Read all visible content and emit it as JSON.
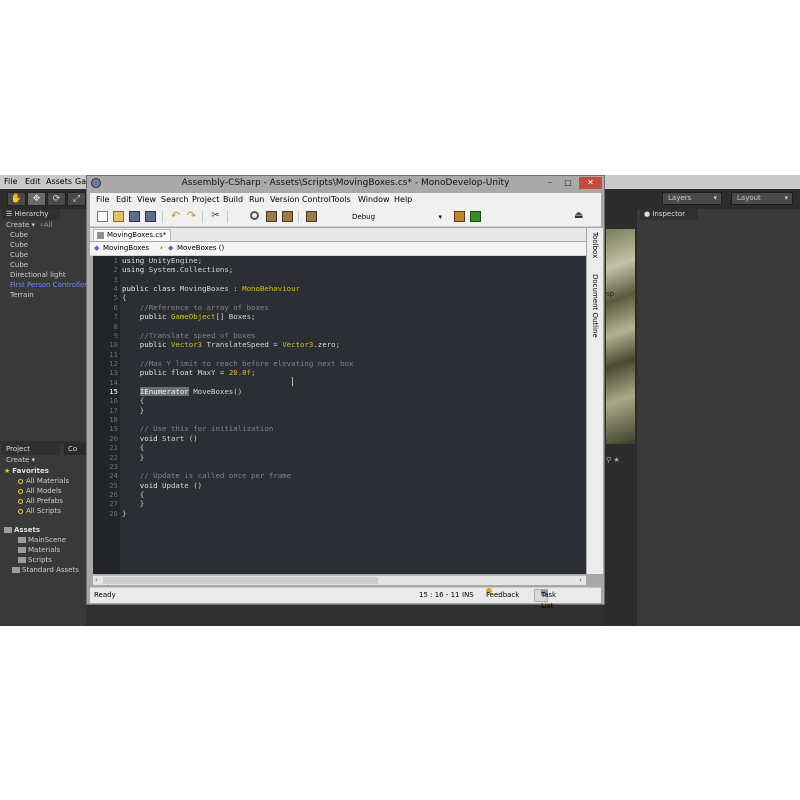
{
  "unity": {
    "menu": [
      "File",
      "Edit",
      "Assets",
      "Ga"
    ],
    "toolbar": {
      "layers_label": "Layers",
      "layout_label": "Layout"
    },
    "hierarchy": {
      "tab": "Hierarchy",
      "create": "Create ▾",
      "search": "⌕All",
      "items": [
        "Cube",
        "Cube",
        "Cube",
        "Cube",
        "Directional light",
        "First Person Controller",
        "Terrain"
      ]
    },
    "project": {
      "tab": "Project",
      "tab2": "Co",
      "create": "Create ▾",
      "favorites_label": "Favorites",
      "favorites": [
        "All Materials",
        "All Models",
        "All Prefabs",
        "All Scripts"
      ],
      "assets_label": "Assets",
      "assets": [
        "MainScene",
        "Materials",
        "Scripts",
        "Standard Assets"
      ]
    },
    "inspector_tab": "Inspector",
    "scene_label": "sp"
  },
  "md": {
    "title": "Assembly-CSharp - Assets\\Scripts\\MovingBoxes.cs* - MonoDevelop-Unity",
    "menu": [
      "File",
      "Edit",
      "View",
      "Search",
      "Project",
      "Build",
      "Run",
      "Version Control",
      "Tools",
      "Window",
      "Help"
    ],
    "config": "Debug",
    "doc_tab": "MovingBoxes.cs*",
    "path": {
      "class": "MovingBoxes",
      "member": "MoveBoxes ()"
    },
    "line_numbers": [
      "1",
      "2",
      "3",
      "4",
      "5",
      "6",
      "7",
      "8",
      "9",
      "10",
      "11",
      "12",
      "13",
      "14",
      "15",
      "16",
      "17",
      "18",
      "19",
      "20",
      "21",
      "22",
      "23",
      "24",
      "25",
      "26",
      "27",
      "28"
    ],
    "current_line": 15,
    "code": {
      "l1a": "using",
      "l1b": " UnityEngine;",
      "l2a": "using",
      "l2b": " System.Collections;",
      "l4a": "public class",
      "l4b": " MovingBoxes : ",
      "l4c": "MonoBehaviour",
      "l5": "{",
      "l6": "    //Reference to array of boxes",
      "l7a": "    public ",
      "l7b": "GameObject",
      "l7c": "[] Boxes;",
      "l9": "    //Translate speed of boxes",
      "l10a": "    public ",
      "l10b": "Vector3",
      "l10c": " TranslateSpeed = ",
      "l10d": "Vector3",
      "l10e": ".zero;",
      "l12": "    //Max Y limit to reach before elevating next box",
      "l13a": "    public float",
      "l13b": " MaxY = ",
      "l13c": "20.0f",
      "l13d": ";",
      "l15a": "    ",
      "l15b": "IEnumerator",
      "l15c": " MoveBoxes()",
      "l16": "    {",
      "l17": "    }",
      "l19": "    // Use this for initialization",
      "l20a": "    void",
      "l20b": " Start ()",
      "l21": "    {",
      "l22": "    }",
      "l24": "    // Update is called once per frame",
      "l25a": "    void",
      "l25b": " Update ()",
      "l26": "    {",
      "l27": "    }",
      "l28": "}"
    },
    "side_tabs": [
      "Toolbox",
      "Document Outline"
    ],
    "status": {
      "ready": "Ready",
      "position": "15 : 16 - 11",
      "mode": "INS",
      "feedback": "Feedback",
      "task_list": "Task List"
    },
    "win_buttons": {
      "minimize": "–",
      "maximize": "□",
      "close": "✕"
    }
  }
}
